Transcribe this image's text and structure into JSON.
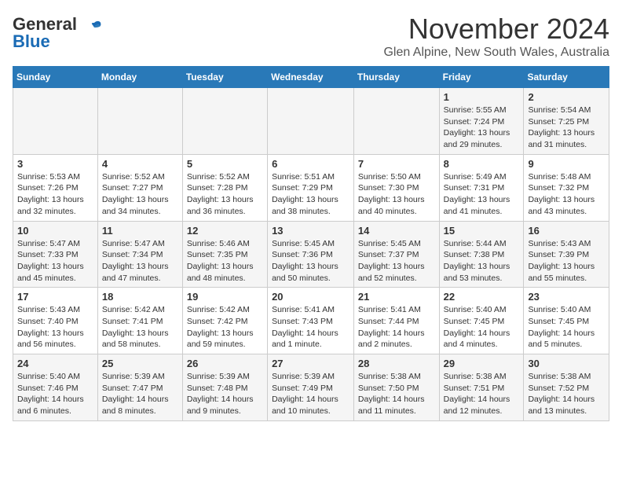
{
  "logo": {
    "general": "General",
    "blue": "Blue"
  },
  "title": "November 2024",
  "subtitle": "Glen Alpine, New South Wales, Australia",
  "headers": [
    "Sunday",
    "Monday",
    "Tuesday",
    "Wednesday",
    "Thursday",
    "Friday",
    "Saturday"
  ],
  "weeks": [
    [
      {
        "day": "",
        "sunrise": "",
        "sunset": "",
        "daylight": ""
      },
      {
        "day": "",
        "sunrise": "",
        "sunset": "",
        "daylight": ""
      },
      {
        "day": "",
        "sunrise": "",
        "sunset": "",
        "daylight": ""
      },
      {
        "day": "",
        "sunrise": "",
        "sunset": "",
        "daylight": ""
      },
      {
        "day": "",
        "sunrise": "",
        "sunset": "",
        "daylight": ""
      },
      {
        "day": "1",
        "sunrise": "5:55 AM",
        "sunset": "7:24 PM",
        "daylight": "13 hours and 29 minutes."
      },
      {
        "day": "2",
        "sunrise": "5:54 AM",
        "sunset": "7:25 PM",
        "daylight": "13 hours and 31 minutes."
      }
    ],
    [
      {
        "day": "3",
        "sunrise": "5:53 AM",
        "sunset": "7:26 PM",
        "daylight": "13 hours and 32 minutes."
      },
      {
        "day": "4",
        "sunrise": "5:52 AM",
        "sunset": "7:27 PM",
        "daylight": "13 hours and 34 minutes."
      },
      {
        "day": "5",
        "sunrise": "5:52 AM",
        "sunset": "7:28 PM",
        "daylight": "13 hours and 36 minutes."
      },
      {
        "day": "6",
        "sunrise": "5:51 AM",
        "sunset": "7:29 PM",
        "daylight": "13 hours and 38 minutes."
      },
      {
        "day": "7",
        "sunrise": "5:50 AM",
        "sunset": "7:30 PM",
        "daylight": "13 hours and 40 minutes."
      },
      {
        "day": "8",
        "sunrise": "5:49 AM",
        "sunset": "7:31 PM",
        "daylight": "13 hours and 41 minutes."
      },
      {
        "day": "9",
        "sunrise": "5:48 AM",
        "sunset": "7:32 PM",
        "daylight": "13 hours and 43 minutes."
      }
    ],
    [
      {
        "day": "10",
        "sunrise": "5:47 AM",
        "sunset": "7:33 PM",
        "daylight": "13 hours and 45 minutes."
      },
      {
        "day": "11",
        "sunrise": "5:47 AM",
        "sunset": "7:34 PM",
        "daylight": "13 hours and 47 minutes."
      },
      {
        "day": "12",
        "sunrise": "5:46 AM",
        "sunset": "7:35 PM",
        "daylight": "13 hours and 48 minutes."
      },
      {
        "day": "13",
        "sunrise": "5:45 AM",
        "sunset": "7:36 PM",
        "daylight": "13 hours and 50 minutes."
      },
      {
        "day": "14",
        "sunrise": "5:45 AM",
        "sunset": "7:37 PM",
        "daylight": "13 hours and 52 minutes."
      },
      {
        "day": "15",
        "sunrise": "5:44 AM",
        "sunset": "7:38 PM",
        "daylight": "13 hours and 53 minutes."
      },
      {
        "day": "16",
        "sunrise": "5:43 AM",
        "sunset": "7:39 PM",
        "daylight": "13 hours and 55 minutes."
      }
    ],
    [
      {
        "day": "17",
        "sunrise": "5:43 AM",
        "sunset": "7:40 PM",
        "daylight": "13 hours and 56 minutes."
      },
      {
        "day": "18",
        "sunrise": "5:42 AM",
        "sunset": "7:41 PM",
        "daylight": "13 hours and 58 minutes."
      },
      {
        "day": "19",
        "sunrise": "5:42 AM",
        "sunset": "7:42 PM",
        "daylight": "13 hours and 59 minutes."
      },
      {
        "day": "20",
        "sunrise": "5:41 AM",
        "sunset": "7:43 PM",
        "daylight": "14 hours and 1 minute."
      },
      {
        "day": "21",
        "sunrise": "5:41 AM",
        "sunset": "7:44 PM",
        "daylight": "14 hours and 2 minutes."
      },
      {
        "day": "22",
        "sunrise": "5:40 AM",
        "sunset": "7:45 PM",
        "daylight": "14 hours and 4 minutes."
      },
      {
        "day": "23",
        "sunrise": "5:40 AM",
        "sunset": "7:45 PM",
        "daylight": "14 hours and 5 minutes."
      }
    ],
    [
      {
        "day": "24",
        "sunrise": "5:40 AM",
        "sunset": "7:46 PM",
        "daylight": "14 hours and 6 minutes."
      },
      {
        "day": "25",
        "sunrise": "5:39 AM",
        "sunset": "7:47 PM",
        "daylight": "14 hours and 8 minutes."
      },
      {
        "day": "26",
        "sunrise": "5:39 AM",
        "sunset": "7:48 PM",
        "daylight": "14 hours and 9 minutes."
      },
      {
        "day": "27",
        "sunrise": "5:39 AM",
        "sunset": "7:49 PM",
        "daylight": "14 hours and 10 minutes."
      },
      {
        "day": "28",
        "sunrise": "5:38 AM",
        "sunset": "7:50 PM",
        "daylight": "14 hours and 11 minutes."
      },
      {
        "day": "29",
        "sunrise": "5:38 AM",
        "sunset": "7:51 PM",
        "daylight": "14 hours and 12 minutes."
      },
      {
        "day": "30",
        "sunrise": "5:38 AM",
        "sunset": "7:52 PM",
        "daylight": "14 hours and 13 minutes."
      }
    ]
  ],
  "labels": {
    "sunrise": "Sunrise:",
    "sunset": "Sunset:",
    "daylight": "Daylight:"
  }
}
